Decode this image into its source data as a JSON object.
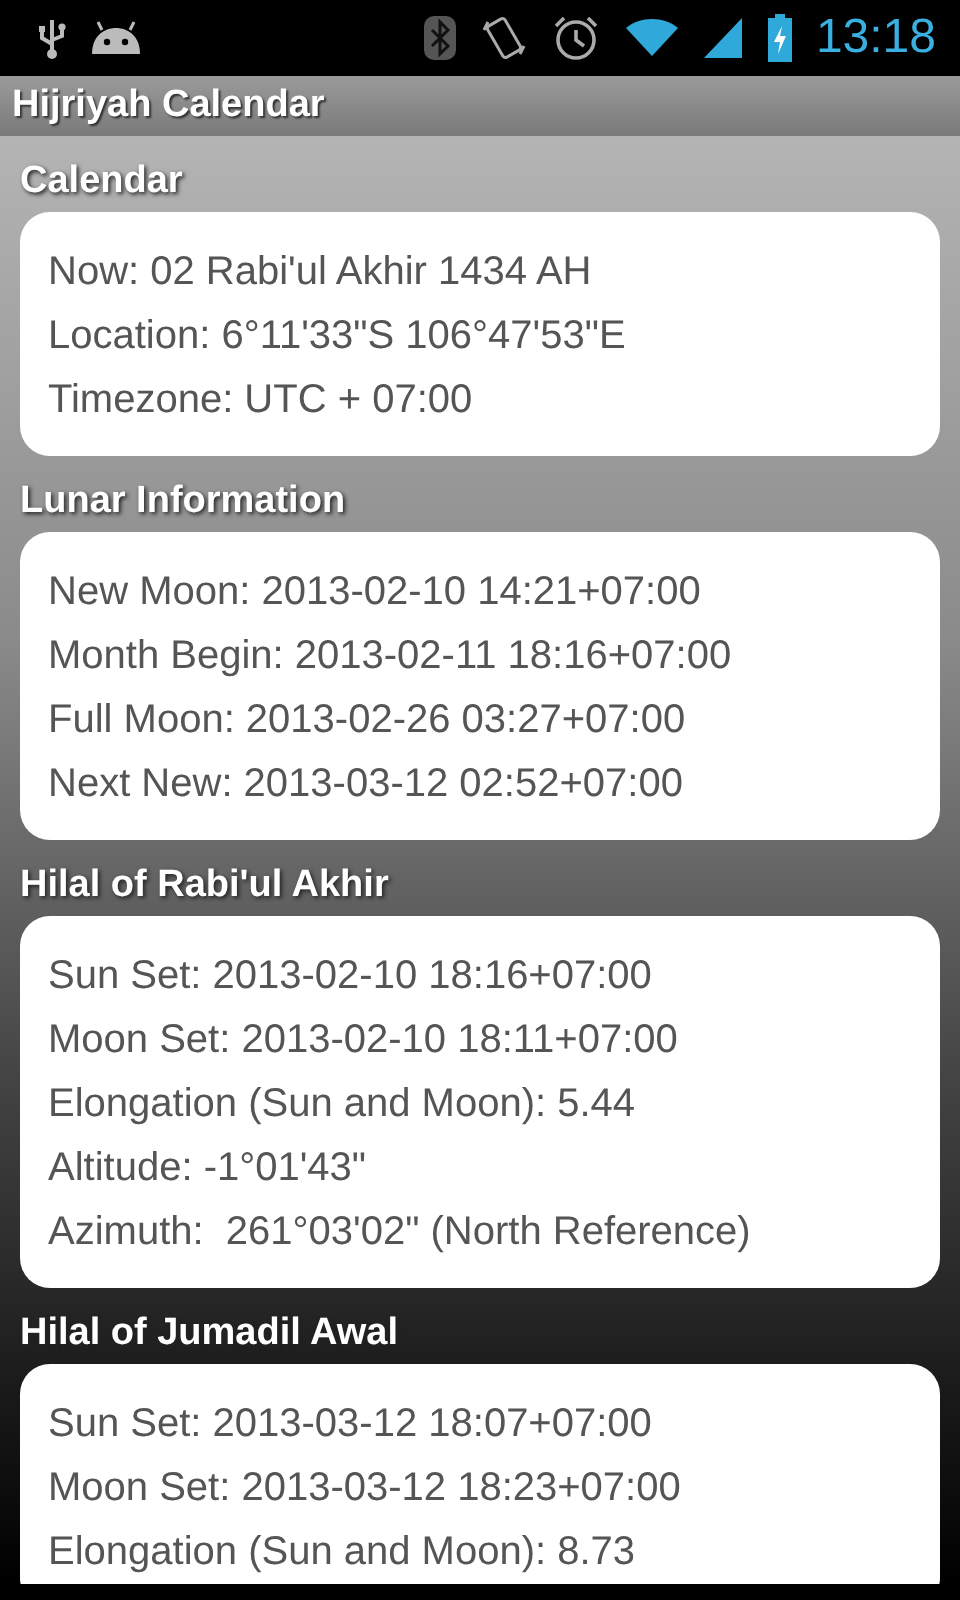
{
  "status_bar": {
    "time": "13:18"
  },
  "app_bar": {
    "title": "Hijriyah Calendar"
  },
  "sections": [
    {
      "heading": "Calendar",
      "lines": [
        "Now: 02 Rabi'ul Akhir 1434 AH",
        "Location: 6°11'33\"S 106°47'53\"E",
        "Timezone: UTC + 07:00"
      ]
    },
    {
      "heading": "Lunar Information",
      "lines": [
        "New Moon: 2013-02-10 14:21+07:00",
        "Month Begin: 2013-02-11 18:16+07:00",
        "Full Moon: 2013-02-26 03:27+07:00",
        "Next New: 2013-03-12 02:52+07:00"
      ]
    },
    {
      "heading": "Hilal of Rabi'ul Akhir",
      "lines": [
        "Sun Set: 2013-02-10 18:16+07:00",
        "Moon Set: 2013-02-10 18:11+07:00",
        "Elongation (Sun and Moon): 5.44",
        "Altitude: -1°01'43\"",
        "Azimuth:  261°03'02\" (North Reference)"
      ]
    },
    {
      "heading": "Hilal of Jumadil Awal",
      "lines": [
        "Sun Set: 2013-03-12 18:07+07:00",
        "Moon Set: 2013-03-12 18:23+07:00",
        "Elongation (Sun and Moon): 8.73"
      ]
    }
  ]
}
